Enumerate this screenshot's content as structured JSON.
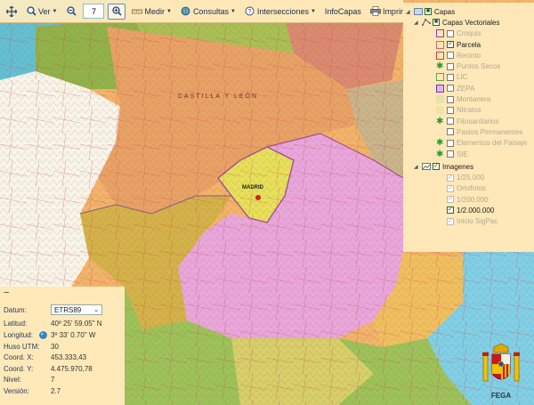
{
  "toolbar": {
    "ver_label": "Ver",
    "zoom_value": "7",
    "medir_label": "Medir",
    "consultas_label": "Consultas",
    "intersecciones_label": "Intersecciones",
    "infocapas_label": "InfoCapas",
    "imprimir_label": "Imprimir"
  },
  "layers": {
    "root_label": "Capas",
    "vector_group_label": "Capas Vectoriales",
    "vector_items": [
      {
        "label": "Croquis",
        "checked": false
      },
      {
        "label": "Parcela",
        "checked": true
      },
      {
        "label": "Recinto",
        "checked": false
      },
      {
        "label": "Puntos Secos",
        "checked": false
      },
      {
        "label": "LIC",
        "checked": false
      },
      {
        "label": "ZEPA",
        "checked": false
      },
      {
        "label": "Montanera",
        "checked": false
      },
      {
        "label": "Nitratos",
        "checked": false
      },
      {
        "label": "Fitosanitarios",
        "checked": false
      },
      {
        "label": "Pastos Permanentes",
        "checked": false
      },
      {
        "label": "Elementos del Paisaje",
        "checked": false
      },
      {
        "label": "SIE",
        "checked": false
      }
    ],
    "images_group_label": "Imagenes",
    "image_items": [
      {
        "label": "1/25.000",
        "checked": true
      },
      {
        "label": "Ortofotos",
        "checked": true
      },
      {
        "label": "1/200.000",
        "checked": true
      },
      {
        "label": "1/2.000.000",
        "checked": true
      },
      {
        "label": "Inicio SigPac",
        "checked": true
      }
    ]
  },
  "info": {
    "collapse_label": "−",
    "datum_label": "Datum:",
    "datum_value": "ETRS89",
    "latitud_label": "Latitud:",
    "latitud_value": "40º 25' 59.05\" N",
    "longitud_label": "Longitud:",
    "longitud_value": "3º 33' 0.70\" W",
    "huso_label": "Huso UTM:",
    "huso_value": "30",
    "coordx_label": "Coord. X:",
    "coordx_value": "453.333,43",
    "coordy_label": "Coord. Y:",
    "coordy_value": "4.475.970,78",
    "nivel_label": "Nivel:",
    "nivel_value": "7",
    "version_label": "Versión:",
    "version_value": "2.7"
  },
  "map_labels": {
    "region_label": "CASTILLA Y LEÓN",
    "capital_label": "MADRID"
  },
  "logo": {
    "text": "FEGA"
  },
  "colors": {
    "panel_bg": "#ffecbe",
    "accent": "#2a6a2a",
    "pink_region": "#e8a6dc",
    "orange_region": "#f0b870",
    "sea": "#9fd6ea"
  }
}
